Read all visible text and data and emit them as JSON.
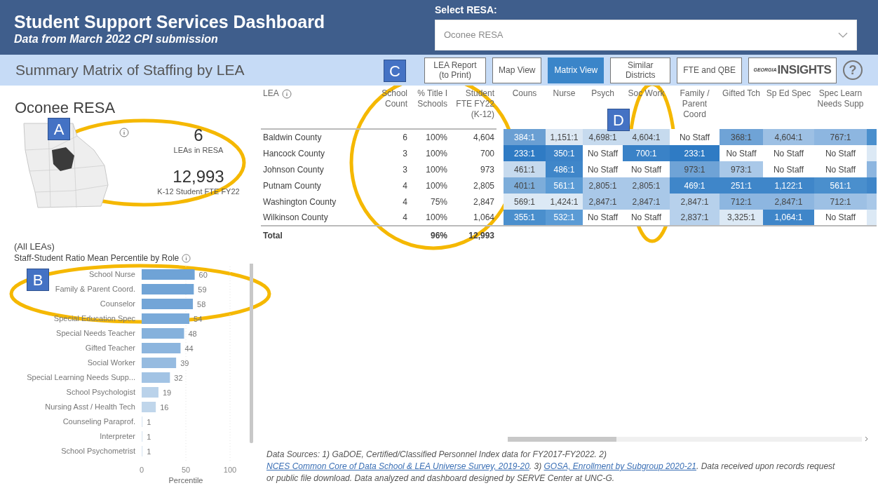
{
  "header": {
    "title": "Student Support Services Dashboard",
    "subtitle": "Data from March 2022 CPI submission"
  },
  "resa_select": {
    "label": "Select RESA:",
    "value": "Oconee RESA"
  },
  "subheader": {
    "title": "Summary Matrix of Staffing by LEA"
  },
  "toolbar": [
    {
      "label": "LEA Report (to Print)",
      "selected": false
    },
    {
      "label": "Map View",
      "selected": false
    },
    {
      "label": "Matrix View",
      "selected": true
    },
    {
      "label": "Similar Districts",
      "selected": false
    },
    {
      "label": "FTE and QBE",
      "selected": false
    }
  ],
  "logo": {
    "small": "GEORGIA",
    "large": "INSIGHTS"
  },
  "help_button": "?",
  "summary": {
    "name": "Oconee RESA",
    "stats": [
      {
        "value": "6",
        "label": "LEAs in RESA"
      },
      {
        "value": "12,993",
        "label": "K-12 Student FTE FY22"
      }
    ]
  },
  "role_chart": {
    "scope": "(All LEAs)",
    "title": "Staff-Student Ratio Mean Percentile by Role",
    "chart_data": {
      "type": "bar",
      "orientation": "horizontal",
      "xlabel": "Percentile",
      "xlim": [
        0,
        100
      ],
      "xticks": [
        0,
        50,
        100
      ],
      "data_labels": true,
      "categories": [
        "School Nurse",
        "Family & Parent Coord.",
        "Counselor",
        "Special Education Spec",
        "Special Needs Teacher",
        "Gifted Teacher",
        "Social Worker",
        "Special Learning Needs Supp...",
        "School Psychologist",
        "Nursing Asst / Health Tech",
        "Counseling Paraprof.",
        "Interpreter",
        "School Psychometrist"
      ],
      "values": [
        60,
        59,
        58,
        54,
        48,
        44,
        39,
        32,
        19,
        16,
        1,
        1,
        1
      ]
    }
  },
  "table": {
    "lea_column": "LEA",
    "columns": [
      "School Count",
      "% Title I Schools",
      "Student FTE FY22 (K-12)"
    ],
    "ratio_columns": [
      "Couns",
      "Nurse",
      "Psych",
      "Soc Work",
      "Family / Parent Coord",
      "Gifted Tch",
      "Sp Ed Spec",
      "Spec Learn Needs Supp"
    ],
    "rows": [
      {
        "lea": "Baldwin County",
        "values": [
          "6",
          "100%",
          "4,604"
        ],
        "ratios": [
          {
            "text": "384:1",
            "color": "#6a9fd3"
          },
          {
            "text": "1,151:1",
            "color": "#dbe7f3"
          },
          {
            "text": "4,698:1",
            "color": "#c6daee"
          },
          {
            "text": "4,604:1",
            "color": "#c6daee"
          },
          {
            "text": "No Staff",
            "color": "#ffffff"
          },
          {
            "text": "368:1",
            "color": "#6fa3d6"
          },
          {
            "text": "4,604:1",
            "color": "#9dc0e4"
          },
          {
            "text": "767:1",
            "color": "#8db6e0"
          }
        ],
        "edge": {
          "color": "#4a8fcd"
        }
      },
      {
        "lea": "Hancock County",
        "values": [
          "3",
          "100%",
          "700"
        ],
        "ratios": [
          {
            "text": "233:1",
            "color": "#2f7bc4"
          },
          {
            "text": "350:1",
            "color": "#3c83c8"
          },
          {
            "text": "No Staff",
            "color": "#ffffff"
          },
          {
            "text": "700:1",
            "color": "#3a82c7"
          },
          {
            "text": "233:1",
            "color": "#2f7bc4"
          },
          {
            "text": "No Staff",
            "color": "#ffffff"
          },
          {
            "text": "No Staff",
            "color": "#ffffff"
          },
          {
            "text": "No Staff",
            "color": "#ffffff"
          }
        ],
        "edge": {
          "color": "#dce9f5"
        }
      },
      {
        "lea": "Johnson County",
        "values": [
          "3",
          "100%",
          "973"
        ],
        "ratios": [
          {
            "text": "461:1",
            "color": "#c6daee"
          },
          {
            "text": "486:1",
            "color": "#3f86c9"
          },
          {
            "text": "No Staff",
            "color": "#ffffff"
          },
          {
            "text": "No Staff",
            "color": "#ffffff"
          },
          {
            "text": "973:1",
            "color": "#6fa3d6"
          },
          {
            "text": "973:1",
            "color": "#a9c8e8"
          },
          {
            "text": "No Staff",
            "color": "#ffffff"
          },
          {
            "text": "No Staff",
            "color": "#ffffff"
          }
        ],
        "edge": {
          "color": "#8db6e0"
        }
      },
      {
        "lea": "Putnam County",
        "values": [
          "4",
          "100%",
          "2,805"
        ],
        "ratios": [
          {
            "text": "401:1",
            "color": "#7dadda"
          },
          {
            "text": "561:1",
            "color": "#5b9bd5"
          },
          {
            "text": "2,805:1",
            "color": "#a9c8e8"
          },
          {
            "text": "2,805:1",
            "color": "#a9c8e8"
          },
          {
            "text": "469:1",
            "color": "#3f86c9"
          },
          {
            "text": "251:1",
            "color": "#3f86c9"
          },
          {
            "text": "1,122:1",
            "color": "#3f86c9"
          },
          {
            "text": "561:1",
            "color": "#4a8fcd"
          }
        ],
        "edge": {
          "color": "#3f86c9"
        }
      },
      {
        "lea": "Washington County",
        "values": [
          "4",
          "75%",
          "2,847"
        ],
        "ratios": [
          {
            "text": "569:1",
            "color": "#dce9f5"
          },
          {
            "text": "1,424:1",
            "color": "#dce9f5"
          },
          {
            "text": "2,847:1",
            "color": "#a9c8e8"
          },
          {
            "text": "2,847:1",
            "color": "#a9c8e8"
          },
          {
            "text": "2,847:1",
            "color": "#b7d1ec"
          },
          {
            "text": "712:1",
            "color": "#8db6e0"
          },
          {
            "text": "2,847:1",
            "color": "#8db6e0"
          },
          {
            "text": "712:1",
            "color": "#9dc0e4"
          }
        ],
        "edge": {
          "color": "#a9c8e8"
        }
      },
      {
        "lea": "Wilkinson County",
        "values": [
          "4",
          "100%",
          "1,064"
        ],
        "ratios": [
          {
            "text": "355:1",
            "color": "#4a8fcd"
          },
          {
            "text": "532:1",
            "color": "#5b9bd5"
          },
          {
            "text": "No Staff",
            "color": "#ffffff"
          },
          {
            "text": "No Staff",
            "color": "#ffffff"
          },
          {
            "text": "2,837:1",
            "color": "#b7d1ec"
          },
          {
            "text": "3,325:1",
            "color": "#dce9f5"
          },
          {
            "text": "1,064:1",
            "color": "#3f86c9"
          },
          {
            "text": "No Staff",
            "color": "#ffffff"
          }
        ],
        "edge": {
          "color": "#dce9f5"
        }
      }
    ],
    "total": {
      "label": "Total",
      "title_i": "96%",
      "student_fte": "12,993"
    }
  },
  "footer": [
    {
      "kind": "text",
      "text": "Data Sources: 1) GaDOE, Certified/Classified Personnel Index data for FY2017-FY2022. 2) "
    },
    {
      "kind": "link",
      "text": "NCES Common Core of Data School & LEA Universe Survey, 2019-20"
    },
    {
      "kind": "text",
      "text": ". 3) "
    },
    {
      "kind": "link",
      "text": "GOSA, Enrollment by Subgroup 2020-21"
    },
    {
      "kind": "text",
      "text": ".  Data received upon records request or public file download. Data analyzed and dashboard designed by SERVE Center at UNC-G."
    }
  ],
  "annotations": [
    {
      "label": "A"
    },
    {
      "label": "B"
    },
    {
      "label": "C"
    },
    {
      "label": "D"
    }
  ]
}
